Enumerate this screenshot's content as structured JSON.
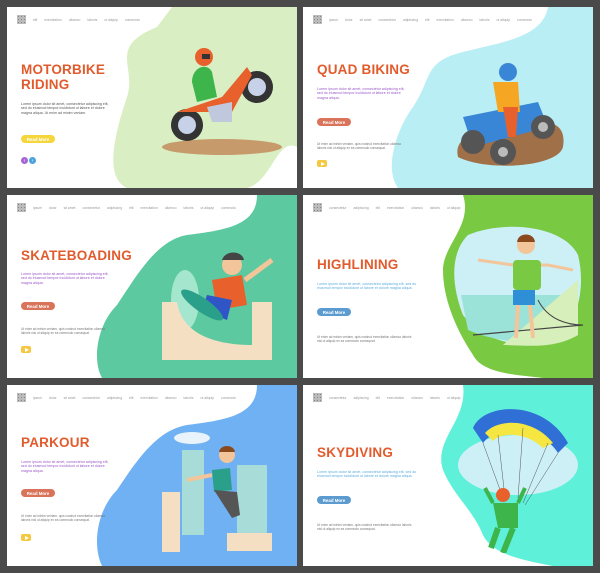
{
  "nav_short": [
    "elit",
    "exercitation",
    "ullamco",
    "laboris",
    "ut aliquip",
    "commodo"
  ],
  "nav_full": [
    "ipsum",
    "dolor",
    "sit amet",
    "consectetur",
    "adipiscing",
    "elit",
    "exercitation",
    "ullamco",
    "laboris",
    "ut aliquip",
    "commodo"
  ],
  "nav_right": [
    "consectetur",
    "adipiscing",
    "elit",
    "exercitation",
    "ullamco",
    "laboris",
    "ut aliquip"
  ],
  "lorem_main": "Lorem ipsum dolor sit amet, consectetur adipiscing elit, sed do eiusmod tempor incididunt ut labore et dolore magna aliqua.",
  "lorem_main_short": "Lorem ipsum dolor sit amet, consectetur adipiscing elit, sed do eiusmod tempor incididunt ut labore et dolore magna aliqua. Ut enim ad minim veniam.",
  "lorem_secondary": "Ut enim ad minim veniam, quis nostrud exercitation ullamco laboris nisi ut aliquip ex ea commodo consequat.",
  "read_more": "Read More",
  "colors": {
    "title": "#e25b2c",
    "btn_yellow": "#f5d63d",
    "btn_orange": "#d9735a",
    "btn_blue": "#5b9bd0",
    "blob_motorbike": "#d9efc3",
    "blob_quad": "#b9eef5",
    "blob_skate": "#5dc9a0",
    "blob_highline": "#7ac943",
    "blob_parkour": "#6fb1f2",
    "blob_skydive": "#5ff0da"
  },
  "panels": [
    {
      "title_line1": "MOTORBIKE",
      "title_line2": "RIDING",
      "sport": "motorbike"
    },
    {
      "title_line1": "QUAD BIKING",
      "sport": "quad"
    },
    {
      "title_line1": "SKATEBOADING",
      "sport": "skateboard"
    },
    {
      "title_line1": "HIGHLINING",
      "sport": "highline"
    },
    {
      "title_line1": "PARKOUR",
      "sport": "parkour"
    },
    {
      "title_line1": "SKYDIVING",
      "sport": "skydive"
    }
  ],
  "arrows": {
    "prev": "‹",
    "next": "›"
  }
}
